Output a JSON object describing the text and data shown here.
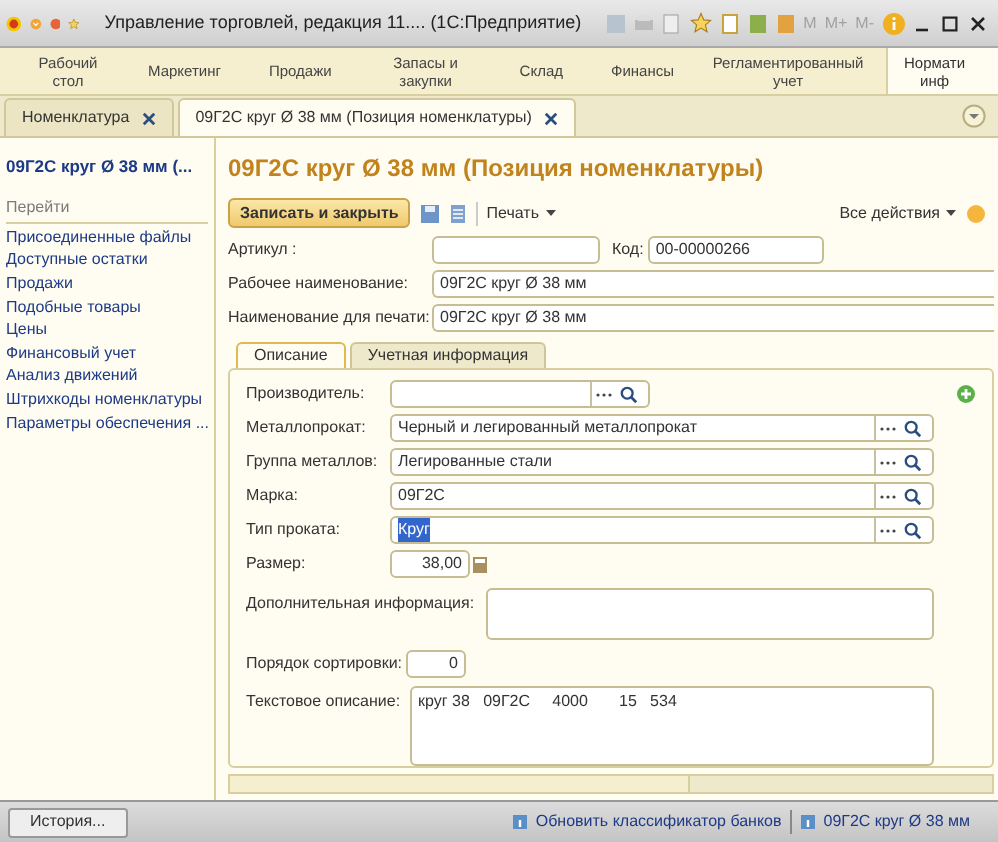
{
  "window": {
    "title": "Управление торговлей, редакция 11.... (1С:Предприятие)",
    "memory_buttons": [
      "M",
      "M+",
      "M-"
    ]
  },
  "sections": [
    {
      "label": "Рабочий стол",
      "selected": false
    },
    {
      "label": "Маркетинг",
      "selected": false
    },
    {
      "label": "Продажи",
      "selected": false
    },
    {
      "label": "Запасы и закупки",
      "selected": false
    },
    {
      "label": "Склад",
      "selected": false
    },
    {
      "label": "Финансы",
      "selected": false
    },
    {
      "label": "Регламентированный учет",
      "selected": false
    },
    {
      "label": "Нормати\nинф",
      "selected": true
    }
  ],
  "doc_tabs": [
    {
      "label": "Номенклатура",
      "selected": false
    },
    {
      "label": "09Г2С круг Ø 38 мм (Позиция номенклатуры)",
      "selected": true
    }
  ],
  "nav_panel": {
    "title": "09Г2С круг Ø 38 мм (...",
    "heading": "Перейти",
    "links": [
      "Присоединенные файлы",
      "Доступные остатки",
      "Продажи",
      "Подобные товары",
      "Цены",
      "Финансовый учет",
      "Анализ движений",
      "Штрихкоды номенклатуры",
      "Параметры обеспечения ..."
    ]
  },
  "form": {
    "title": "09Г2С круг Ø 38 мм (Позиция номенклатуры)",
    "save_close": "Записать и закрыть",
    "print": "Печать",
    "all_actions": "Все действия",
    "article_label": "Артикул :",
    "code_label": "Код:",
    "code_value": "00-00000266",
    "header_fields": [
      {
        "label": "Рабочее наименование:",
        "value": "09Г2С круг Ø 38 мм"
      },
      {
        "label": "Наименование для печати:",
        "value": "09Г2С круг Ø 38 мм"
      }
    ],
    "tabs": [
      {
        "label": "Описание",
        "selected": true
      },
      {
        "label": "Учетная информация",
        "selected": false
      }
    ],
    "fields": [
      {
        "kind": "short_select",
        "label": "Производитель:",
        "selected": false
      },
      {
        "kind": "select",
        "label": "Металлопрокат:",
        "value": "Черный и легированный металлопрокат",
        "selected": false
      },
      {
        "kind": "select",
        "label": "Группа металлов:",
        "value": "Легированные стали",
        "selected": false
      },
      {
        "kind": "select",
        "label": "Марка:",
        "value": "09Г2С",
        "selected": false
      },
      {
        "kind": "select",
        "label": "Тип проката:",
        "value": "Круг",
        "selected": true
      },
      {
        "kind": "number",
        "label": "Размер:",
        "value": "38,00",
        "selected": false
      },
      {
        "kind": "memo",
        "label": "Дополнительная информация:",
        "selected": false
      },
      {
        "kind": "sort",
        "label": "Порядок сортировки:",
        "value": "0",
        "selected": false
      },
      {
        "kind": "text",
        "label": "Текстовое описание:",
        "value": "круг 38   09Г2С     4000       15   534",
        "selected": false
      }
    ]
  },
  "status_bar": {
    "history": "История...",
    "links": [
      "Обновить классификатор банков",
      "09Г2С круг Ø 38 мм"
    ]
  }
}
